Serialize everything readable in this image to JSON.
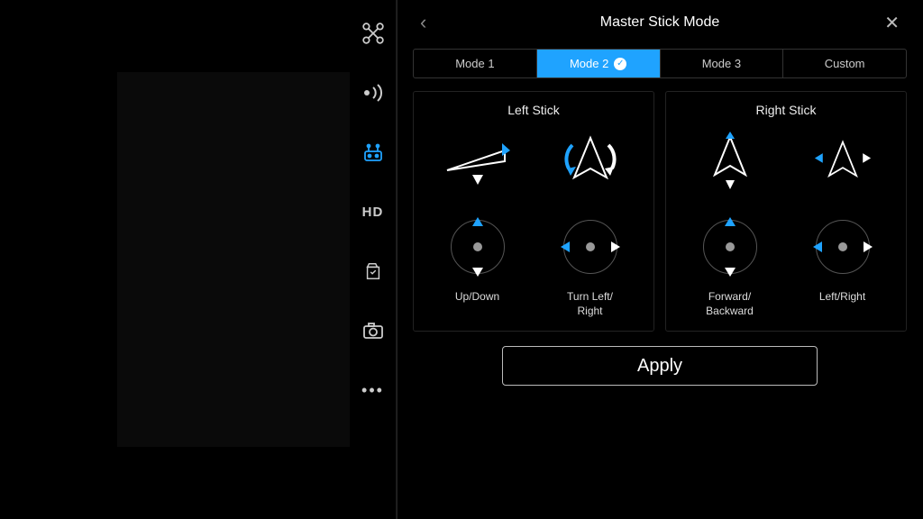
{
  "colors": {
    "accent": "#1fa3ff"
  },
  "sidebar": {
    "items": [
      {
        "name": "aircraft-icon"
      },
      {
        "name": "signal-icon"
      },
      {
        "name": "rc-icon",
        "active": true,
        "label": "RC"
      },
      {
        "name": "hd-icon",
        "label": "HD"
      },
      {
        "name": "battery-icon"
      },
      {
        "name": "camera-icon"
      },
      {
        "name": "more-icon"
      }
    ]
  },
  "panel": {
    "title": "Master Stick Mode",
    "tabs": [
      {
        "label": "Mode 1"
      },
      {
        "label": "Mode 2",
        "active": true
      },
      {
        "label": "Mode 3"
      },
      {
        "label": "Custom"
      }
    ],
    "left_stick": {
      "title": "Left Stick",
      "axis1_label": "Up/Down",
      "axis2_label": "Turn Left/\nRight"
    },
    "right_stick": {
      "title": "Right Stick",
      "axis1_label": "Forward/\nBackward",
      "axis2_label": "Left/Right"
    },
    "apply_label": "Apply"
  }
}
